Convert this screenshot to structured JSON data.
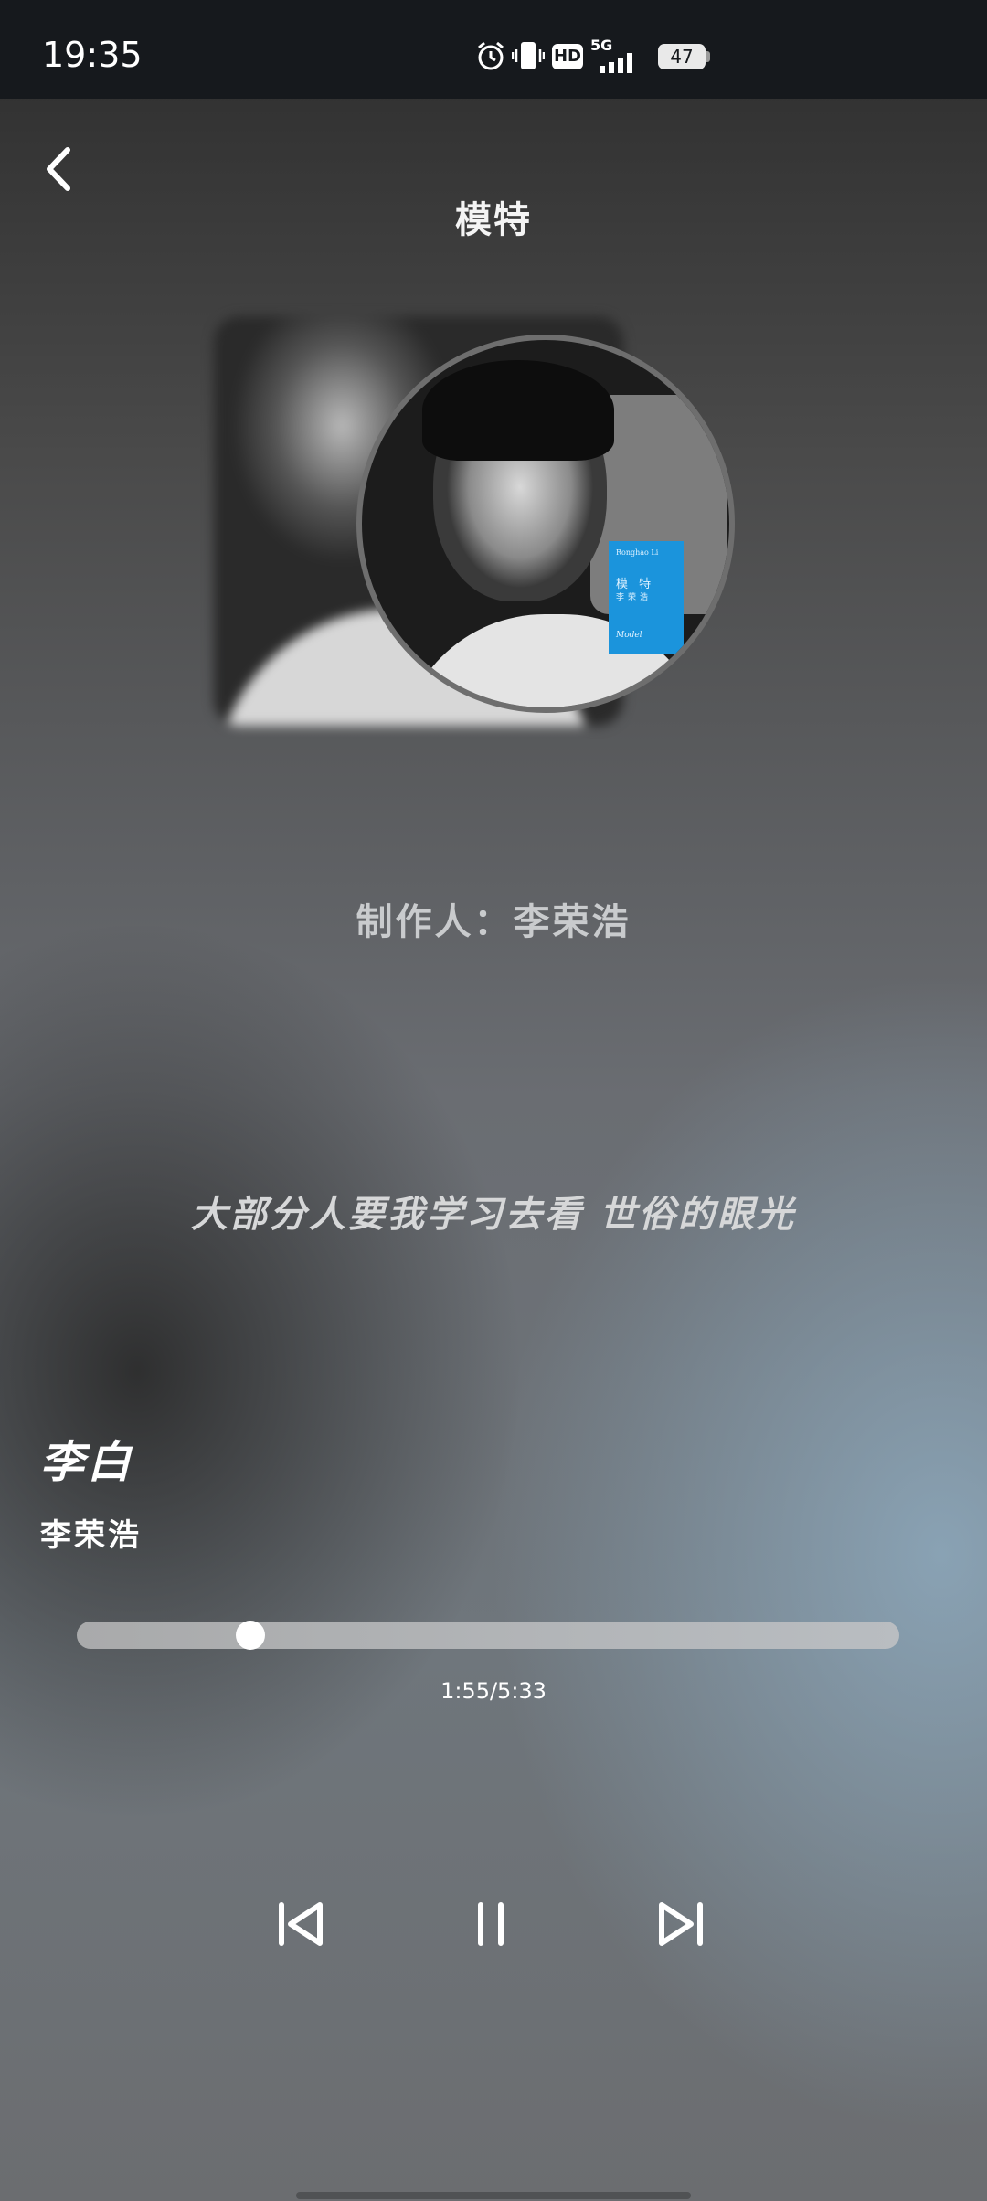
{
  "status_bar": {
    "time": "19:35",
    "network": "5G",
    "hd_label": "HD",
    "battery": "47",
    "icons": [
      "alarm-icon",
      "vibrate-icon",
      "hd-icon",
      "signal-icon",
      "battery-icon"
    ]
  },
  "header": {
    "title": "模特",
    "back_icon": "chevron-left-icon"
  },
  "album": {
    "card_text_1": "Ronghao Li",
    "card_text_2": "模 特",
    "card_text_3": "李荣浩",
    "card_text_4": "Model"
  },
  "lyrics": {
    "producer": "制作人：李荣浩",
    "current_line": "大部分人要我学习去看 世俗的眼光"
  },
  "track": {
    "title": "李白",
    "artist": "李荣浩"
  },
  "progress": {
    "elapsed_display": "1:55/5:33",
    "fraction": 0.211
  },
  "controls": {
    "previous_icon": "skip-previous-icon",
    "pause_icon": "pause-icon",
    "next_icon": "skip-next-icon"
  },
  "colors": {
    "status_bar_bg": "#16191d",
    "album_card": "#1b94dc",
    "thumb": "#ffffff"
  }
}
